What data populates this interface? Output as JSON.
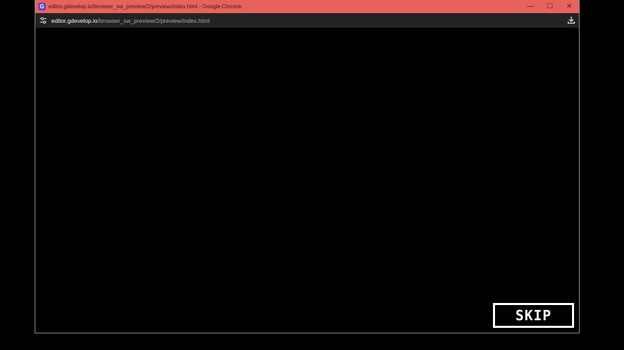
{
  "window": {
    "title": "editor.gdevelop.io/browser_sw_preview/2/preview/index.html - Google Chrome",
    "app_icon": "chrome-gdevelop-icon",
    "controls": {
      "minimize": "—",
      "maximize": "☐",
      "close": "✕"
    },
    "colors": {
      "titlebar": "#e8625c",
      "toolbar": "#232323",
      "viewport": "#000000"
    }
  },
  "address_bar": {
    "host": "editor.gdevelop.io",
    "path": "/browser_sw_preview/2/preview/index.html",
    "site_icon": "tune-icon",
    "download_icon": "download-icon"
  },
  "game": {
    "skip_label": "SKIP"
  }
}
